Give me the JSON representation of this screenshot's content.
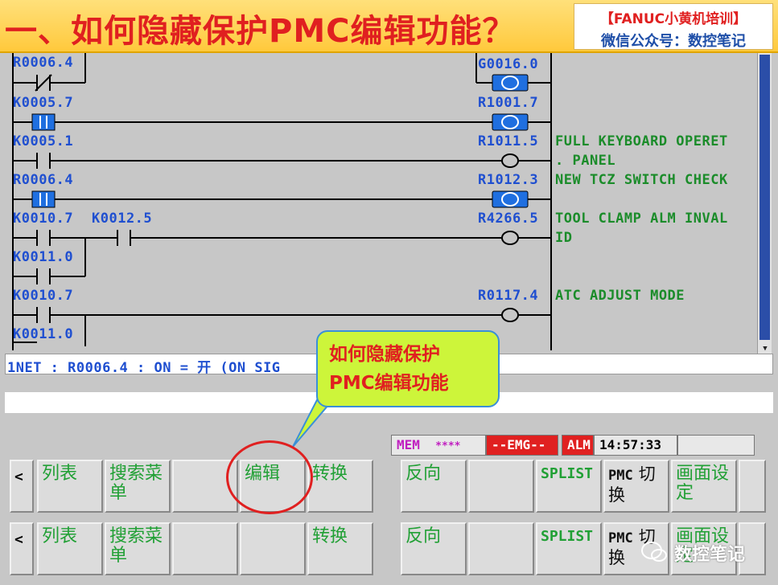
{
  "banner": {
    "title": "一、如何隐藏保护PMC编辑功能？",
    "brand_line1": "【FANUC小黄机培训】",
    "brand_line2": "微信公众号：数控笔记"
  },
  "ladder": {
    "addresses": {
      "a1": "R0006.4",
      "a2": "K0005.7",
      "a3": "K0005.1",
      "a4": "R0006.4",
      "a5": "K0010.7",
      "a6": "K0012.5",
      "a7": "K0011.0",
      "a8": "K0010.7",
      "a9": "K0011.0",
      "c1": "G0016.0",
      "c2": "R1001.7",
      "c3": "R1011.5",
      "c4": "R1012.3",
      "c5": "R4266.5",
      "c6": "R0117.4"
    },
    "comments": {
      "m1": "FULL KEYBOARD OPERET",
      "m2": ". PANEL",
      "m3": "NEW TCZ SWITCH CHECK",
      "m4": "TOOL CLAMP ALM INVAL",
      "m5": "ID",
      "m6": "ATC ADJUST MODE"
    }
  },
  "status_line": "1NET : R0006.4 : ON = 开 (ON SIG",
  "callout": {
    "line1": "如何隐藏保护",
    "line2": "PMC编辑功能"
  },
  "status_bar": {
    "mode": "MEM",
    "stars": "****",
    "emg": "--EMG--",
    "alm": "ALM",
    "time": "14:57:33"
  },
  "softkeys_row1": {
    "left_arrow": "<",
    "k1": "列表",
    "k2": "搜索菜单",
    "k3": "",
    "k4": "编辑",
    "k5": "转换",
    "k6": "反向",
    "k7": "",
    "k8": "SPLIST",
    "k9a": "PMC",
    "k9b": "切换",
    "k10": "画面设定"
  },
  "softkeys_row2": {
    "left_arrow": "<",
    "k1": "列表",
    "k2": "搜索菜单",
    "k3": "",
    "k4": "",
    "k5": "转换",
    "k6": "反向",
    "k7": "",
    "k8": "SPLIST",
    "k9a": "PMC",
    "k9b": "切换",
    "k10": "画面设定"
  },
  "watermark": "数控笔记",
  "colors": {
    "title_red": "#e02020",
    "address_blue": "#1f4fd0",
    "comment_green": "#1b8c2a",
    "callout_bg": "#cdf53a",
    "emg_red": "#e02020"
  }
}
